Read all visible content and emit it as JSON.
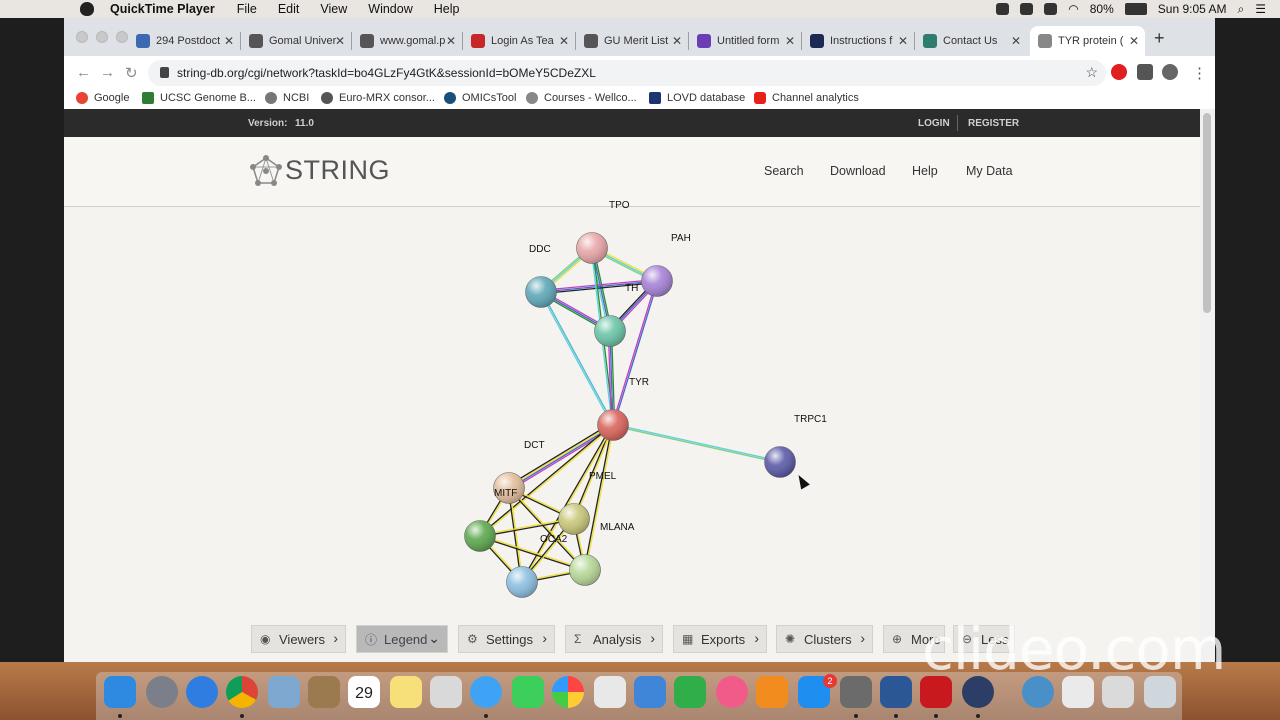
{
  "menubar": {
    "app_name": "QuickTime Player",
    "items": [
      "File",
      "Edit",
      "View",
      "Window",
      "Help"
    ],
    "battery": "80%",
    "clock": "Sun 9:05 AM"
  },
  "browser": {
    "tabs": [
      {
        "label": "294 Postdoct",
        "color": "#3c6ab0"
      },
      {
        "label": "Gomal Univer",
        "color": "#555"
      },
      {
        "label": "www.gomal.p",
        "color": "#555"
      },
      {
        "label": "Login As Tea",
        "color": "#c62828"
      },
      {
        "label": "GU Merit List",
        "color": "#555"
      },
      {
        "label": "Untitled form",
        "color": "#6a3fb5"
      },
      {
        "label": "Instructions f",
        "color": "#1a2a55"
      },
      {
        "label": "Contact Us",
        "color": "#2e7d6e"
      },
      {
        "label": "TYR protein (",
        "color": "#888"
      }
    ],
    "url": "string-db.org/cgi/network?taskId=bo4GLzFy4GtK&sessionId=bOMeY5CDeZXL",
    "bookmarks": [
      "Google",
      "UCSC Genome B...",
      "NCBI",
      "Euro-MRX consor...",
      "OMICsTool",
      "Courses - Wellco...",
      "LOVD database",
      "Channel analytics"
    ]
  },
  "site": {
    "version_label": "Version:",
    "version": "11.0",
    "login": "LOGIN",
    "register": "REGISTER",
    "logo": "STRING",
    "nav": [
      "Search",
      "Download",
      "Help",
      "My Data"
    ]
  },
  "network": {
    "nodes": [
      {
        "label": "TPO",
        "color": "#e8a6a8"
      },
      {
        "label": "DDC",
        "color": "#5fa8b8"
      },
      {
        "label": "PAH",
        "color": "#a783d6"
      },
      {
        "label": "TH",
        "color": "#6cc5a8"
      },
      {
        "label": "TYR",
        "color": "#d9655c"
      },
      {
        "label": "TRPC1",
        "color": "#5b5ba8"
      },
      {
        "label": "DCT",
        "color": "#e3bd9c"
      },
      {
        "label": "PMEL",
        "color": "#c9c77a"
      },
      {
        "label": "MITF",
        "color": "#5ea84e"
      },
      {
        "label": "MLANA",
        "color": "#b8d89a"
      },
      {
        "label": "OCA2",
        "color": "#8cc0e0"
      }
    ]
  },
  "toolbar_buttons": [
    "Viewers",
    "Legend",
    "Settings",
    "Analysis",
    "Exports",
    "Clusters",
    "More",
    "Less"
  ],
  "dock": {
    "calendar_month": "NOV",
    "calendar_day": "29",
    "badge": "2"
  },
  "watermark": "clideo.com"
}
